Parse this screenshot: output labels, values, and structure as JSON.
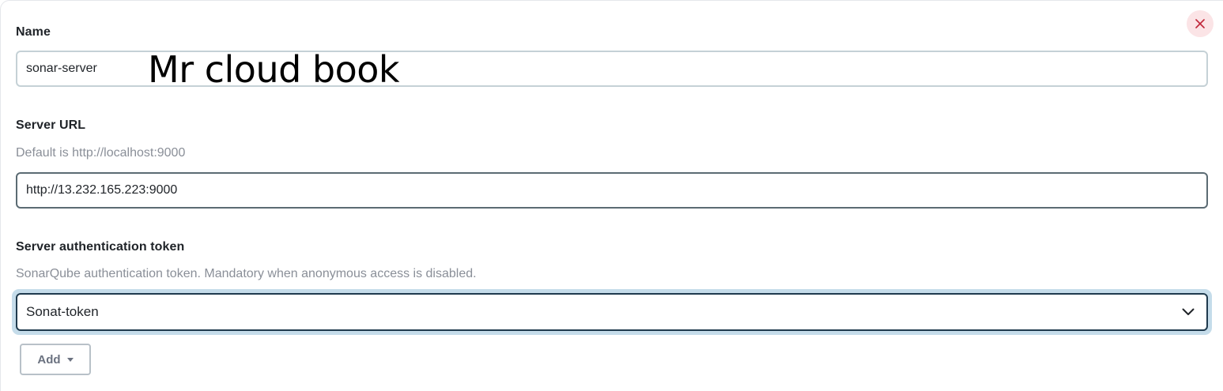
{
  "dialog": {
    "close_icon": "close-icon",
    "close_color": "#c0273a"
  },
  "name": {
    "label": "Name",
    "value": "sonar-server"
  },
  "server_url": {
    "label": "Server URL",
    "help": "Default is http://localhost:9000",
    "value": "http://13.232.165.223:9000"
  },
  "auth_token": {
    "label": "Server authentication token",
    "help": "SonarQube authentication token. Mandatory when anonymous access is disabled.",
    "selected": "Sonat-token",
    "chevron_icon": "chevron-down-icon"
  },
  "add_button": {
    "label": "Add",
    "icon": "caret-down-icon"
  },
  "watermark": {
    "text": "Mr cloud book"
  }
}
